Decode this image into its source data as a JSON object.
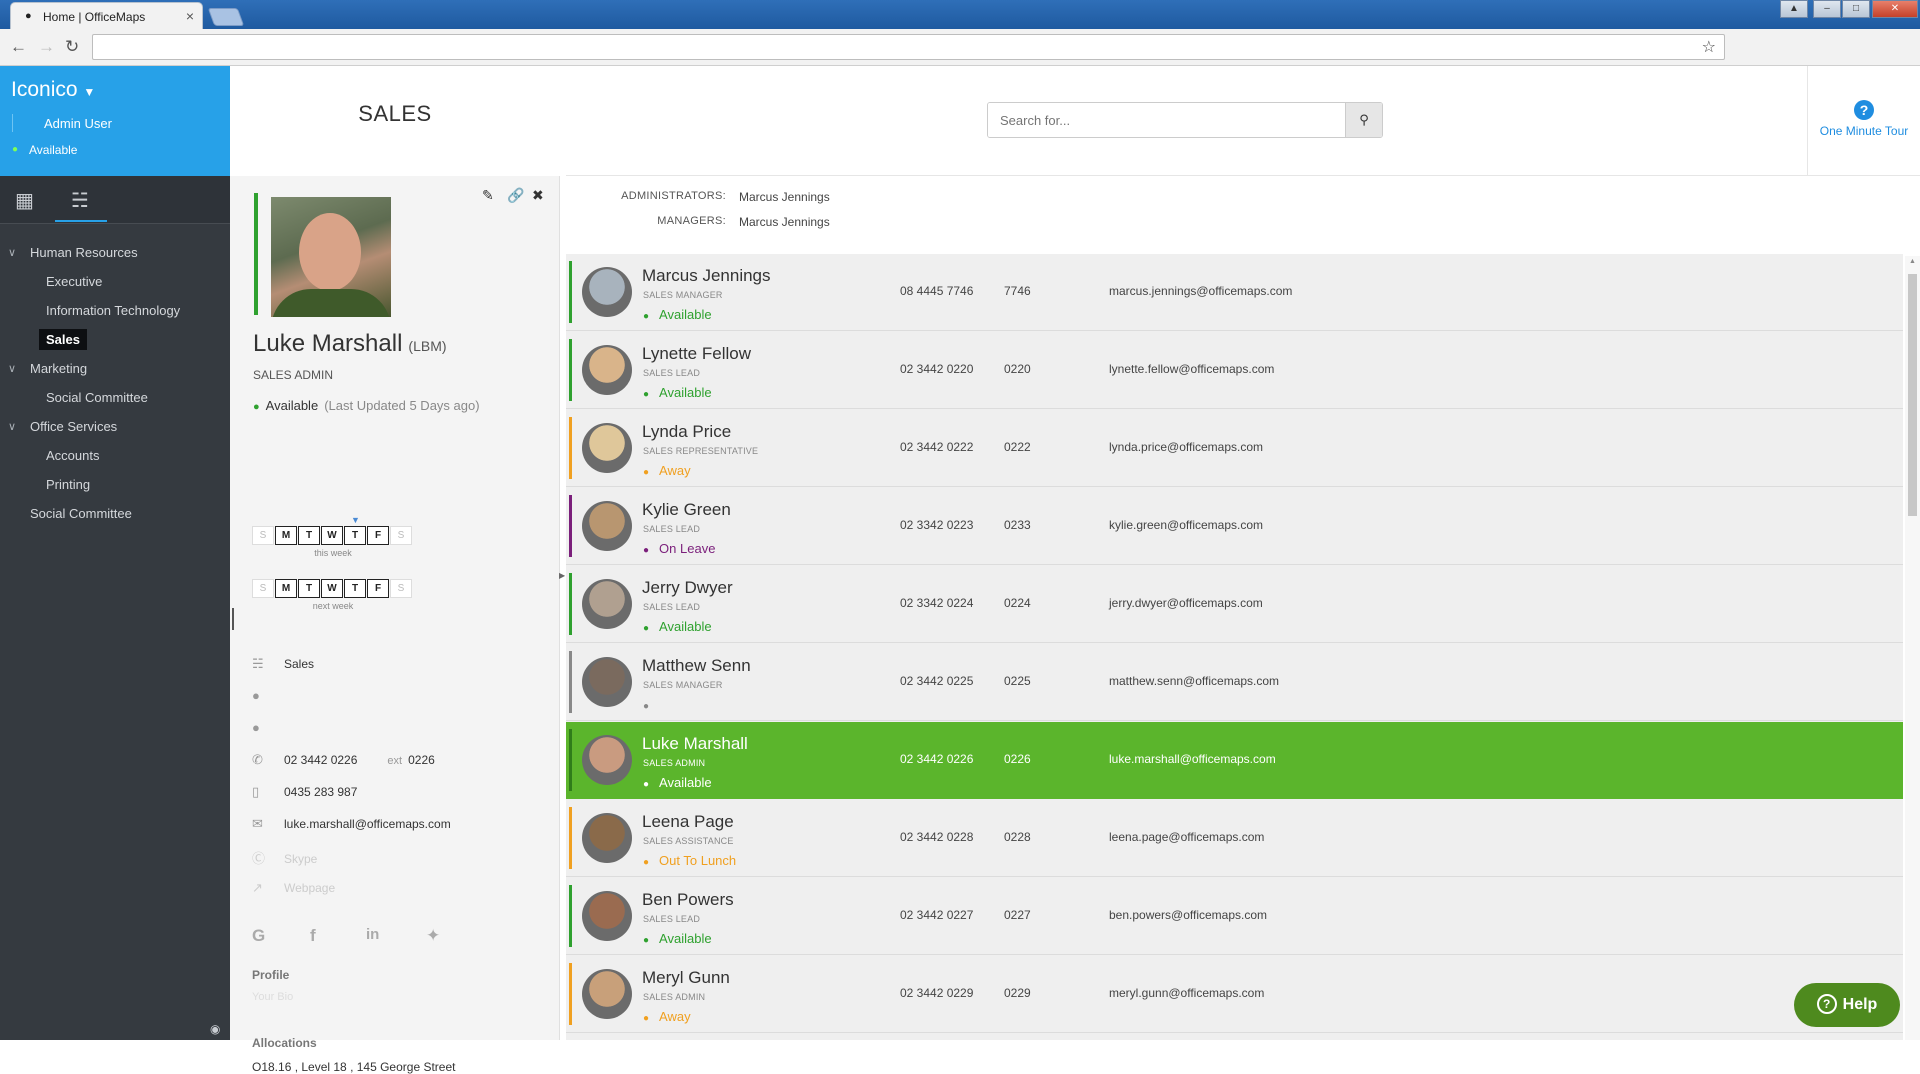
{
  "browser": {
    "tab_title": "Home | OfficeMaps",
    "address": ""
  },
  "sidebar": {
    "org": "Iconico",
    "user": "Admin User",
    "status": "Available",
    "tree": [
      {
        "label": "Human Resources",
        "expanded": true
      },
      {
        "label": "Executive"
      },
      {
        "label": "Information Technology"
      },
      {
        "label": "Sales",
        "selected": true
      },
      {
        "label": "Marketing",
        "expanded": true
      },
      {
        "label": "Social Committee"
      },
      {
        "label": "Office Services",
        "expanded": true
      },
      {
        "label": "Accounts"
      },
      {
        "label": "Printing"
      },
      {
        "label": "Social Committee"
      }
    ]
  },
  "profile": {
    "department": "SALES",
    "name": "Luke Marshall",
    "initials": "(LBM)",
    "title": "SALES ADMIN",
    "status": "Available",
    "updated": "(Last Updated 5 Days ago)",
    "week_days": [
      "S",
      "M",
      "T",
      "W",
      "T",
      "F",
      "S"
    ],
    "this_week_label": "this week",
    "next_week_label": "next week",
    "group": "Sales",
    "phone": "02 3442 0226",
    "ext_label": "ext",
    "ext": "0226",
    "mobile": "0435 283 987",
    "email": "luke.marshall@officemaps.com",
    "skype_placeholder": "Skype",
    "webpage_placeholder": "Webpage",
    "profile_label": "Profile",
    "bio_placeholder": "Your Bio",
    "allocations_label": "Allocations",
    "allocation": "O18.16 , Level 18 , 145 George Street"
  },
  "main": {
    "search_placeholder": "Search for...",
    "tour_label": "One Minute Tour",
    "administrators_label": "ADMINISTRATORS:",
    "administrators": "Marcus Jennings",
    "managers_label": "MANAGERS:",
    "managers": "Marcus Jennings",
    "help_label": "Help"
  },
  "people": [
    {
      "name": "Marcus Jennings",
      "role": "SALES MANAGER",
      "status": "Available",
      "phone": "08 4445 7746",
      "ext": "7746",
      "email": "marcus.jennings@officemaps.com",
      "color": "#2fa12f",
      "avatar": "#a8b3bd"
    },
    {
      "name": "Lynette Fellow",
      "role": "SALES LEAD",
      "status": "Available",
      "phone": "02 3442 0220",
      "ext": "0220",
      "email": "lynette.fellow@officemaps.com",
      "color": "#2fa12f",
      "avatar": "#d9b48a"
    },
    {
      "name": "Lynda Price",
      "role": "SALES REPRESENTATIVE",
      "status": "Away",
      "phone": "02 3442 0222",
      "ext": "0222",
      "email": "lynda.price@officemaps.com",
      "color": "#f0a020",
      "avatar": "#dfc79a"
    },
    {
      "name": "Kylie Green",
      "role": "SALES LEAD",
      "status": "On Leave",
      "phone": "02 3342 0223",
      "ext": "0233",
      "email": "kylie.green@officemaps.com",
      "color": "#7b1f7b",
      "avatar": "#b89670"
    },
    {
      "name": "Jerry Dwyer",
      "role": "SALES LEAD",
      "status": "Available",
      "phone": "02 3342 0224",
      "ext": "0224",
      "email": "jerry.dwyer@officemaps.com",
      "color": "#2fa12f",
      "avatar": "#b0a090"
    },
    {
      "name": "Matthew Senn",
      "role": "SALES MANAGER",
      "status": "",
      "phone": "02 3442 0225",
      "ext": "0225",
      "email": "matthew.senn@officemaps.com",
      "color": "#888888",
      "avatar": "#7a6a5e"
    },
    {
      "name": "Luke Marshall",
      "role": "SALES ADMIN",
      "status": "Available",
      "phone": "02 3442 0226",
      "ext": "0226",
      "email": "luke.marshall@officemaps.com",
      "color": "#2f7d1a",
      "avatar": "#c99b80",
      "active": true
    },
    {
      "name": "Leena Page",
      "role": "SALES ASSISTANCE",
      "status": "Out To Lunch",
      "phone": "02 3442 0228",
      "ext": "0228",
      "email": "leena.page@officemaps.com",
      "color": "#f0a020",
      "avatar": "#8a6a4a"
    },
    {
      "name": "Ben Powers",
      "role": "SALES LEAD",
      "status": "Available",
      "phone": "02 3442 0227",
      "ext": "0227",
      "email": "ben.powers@officemaps.com",
      "color": "#2fa12f",
      "avatar": "#9a6b50"
    },
    {
      "name": "Meryl Gunn",
      "role": "SALES ADMIN",
      "status": "Away",
      "phone": "02 3442 0229",
      "ext": "0229",
      "email": "meryl.gunn@officemaps.com",
      "color": "#f0a020",
      "avatar": "#c8a07a"
    }
  ],
  "status_colors": {
    "Available": "#2fa12f",
    "Away": "#f0a020",
    "Out To Lunch": "#f0a020",
    "On Leave": "#7b1f7b",
    "": "#888888"
  }
}
